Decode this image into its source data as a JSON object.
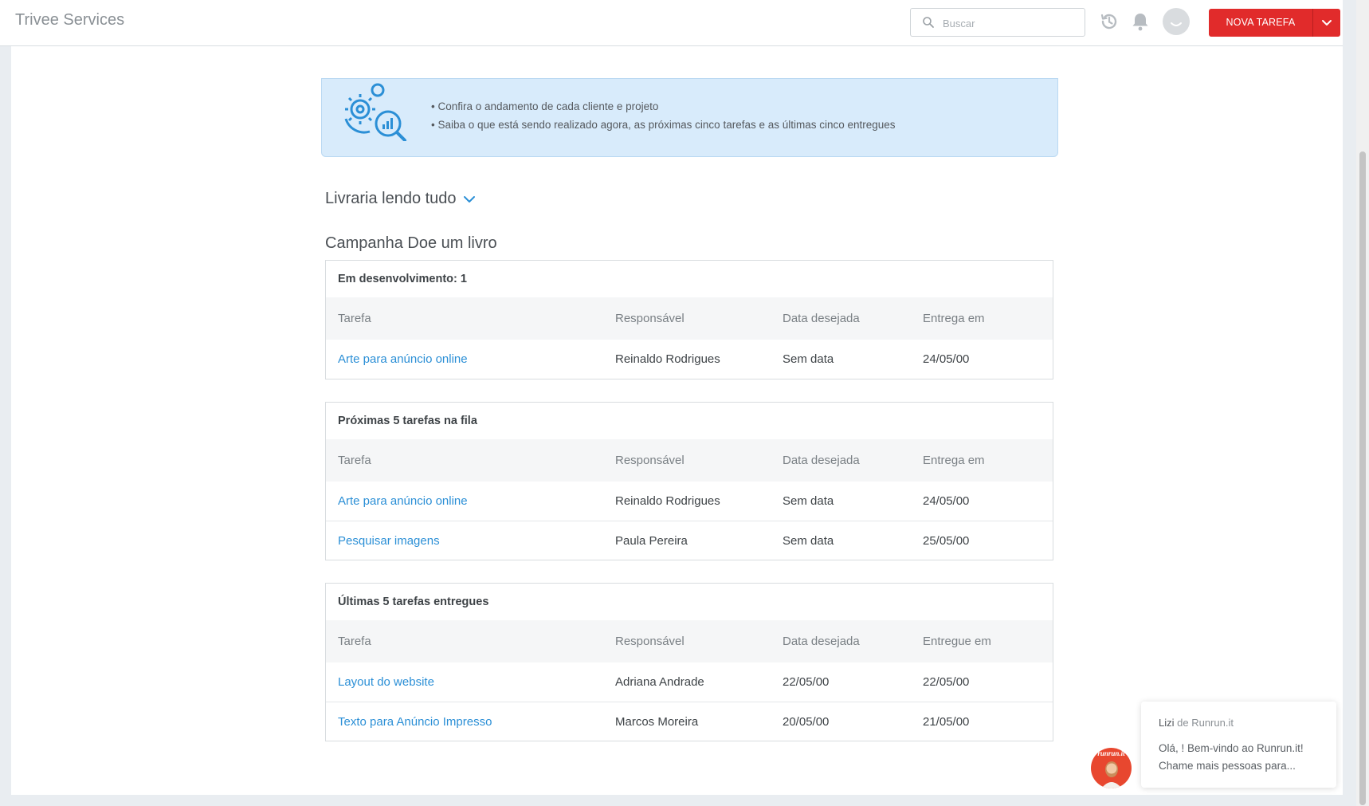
{
  "header": {
    "app_title": "Trivee Services",
    "search_placeholder": "Buscar",
    "new_task_label": "NOVA TAREFA"
  },
  "banner": {
    "lines": [
      "• Confira o andamento de cada cliente e projeto",
      "• Saiba o que está sendo realizado agora, as próximas cinco tarefas e as últimas cinco entregues"
    ]
  },
  "client": {
    "name": "Livraria lendo tudo"
  },
  "project": {
    "title": "Campanha Doe um livro"
  },
  "in_progress": {
    "title": "Em desenvolvimento: 1",
    "columns": [
      "Tarefa",
      "Responsável",
      "Data desejada",
      "Entrega em"
    ],
    "rows": [
      [
        "Arte para anúncio online",
        "Reinaldo Rodrigues",
        "Sem data",
        "24/05/00"
      ]
    ]
  },
  "next_tasks": {
    "title": "Próximas 5 tarefas na fila",
    "columns": [
      "Tarefa",
      "Responsável",
      "Data desejada",
      "Entrega em"
    ],
    "rows": [
      [
        "Arte para anúncio online",
        "Reinaldo Rodrigues",
        "Sem data",
        "24/05/00"
      ],
      [
        "Pesquisar imagens",
        "Paula Pereira",
        "Sem data",
        "25/05/00"
      ]
    ]
  },
  "delivered": {
    "title": "Últimas 5 tarefas entregues",
    "columns": [
      "Tarefa",
      "Responsável",
      "Data desejada",
      "Entregue em"
    ],
    "rows": [
      [
        "Layout do website",
        "Adriana Andrade",
        "22/05/00",
        "22/05/00"
      ],
      [
        "Texto para Anúncio Impresso",
        "Marcos Moreira",
        "20/05/00",
        "21/05/00"
      ]
    ]
  },
  "chat": {
    "sender": "Lizi",
    "sender_suffix": "de Runrun.it",
    "message": "Olá, ! Bem-vindo ao Runrun.it! Chame mais pessoas para...",
    "avatar_brand": "runrun.it"
  },
  "colors": {
    "accent": "#e12b2b",
    "link": "#2b8fd6",
    "banner_bg": "#d8ebfb"
  }
}
